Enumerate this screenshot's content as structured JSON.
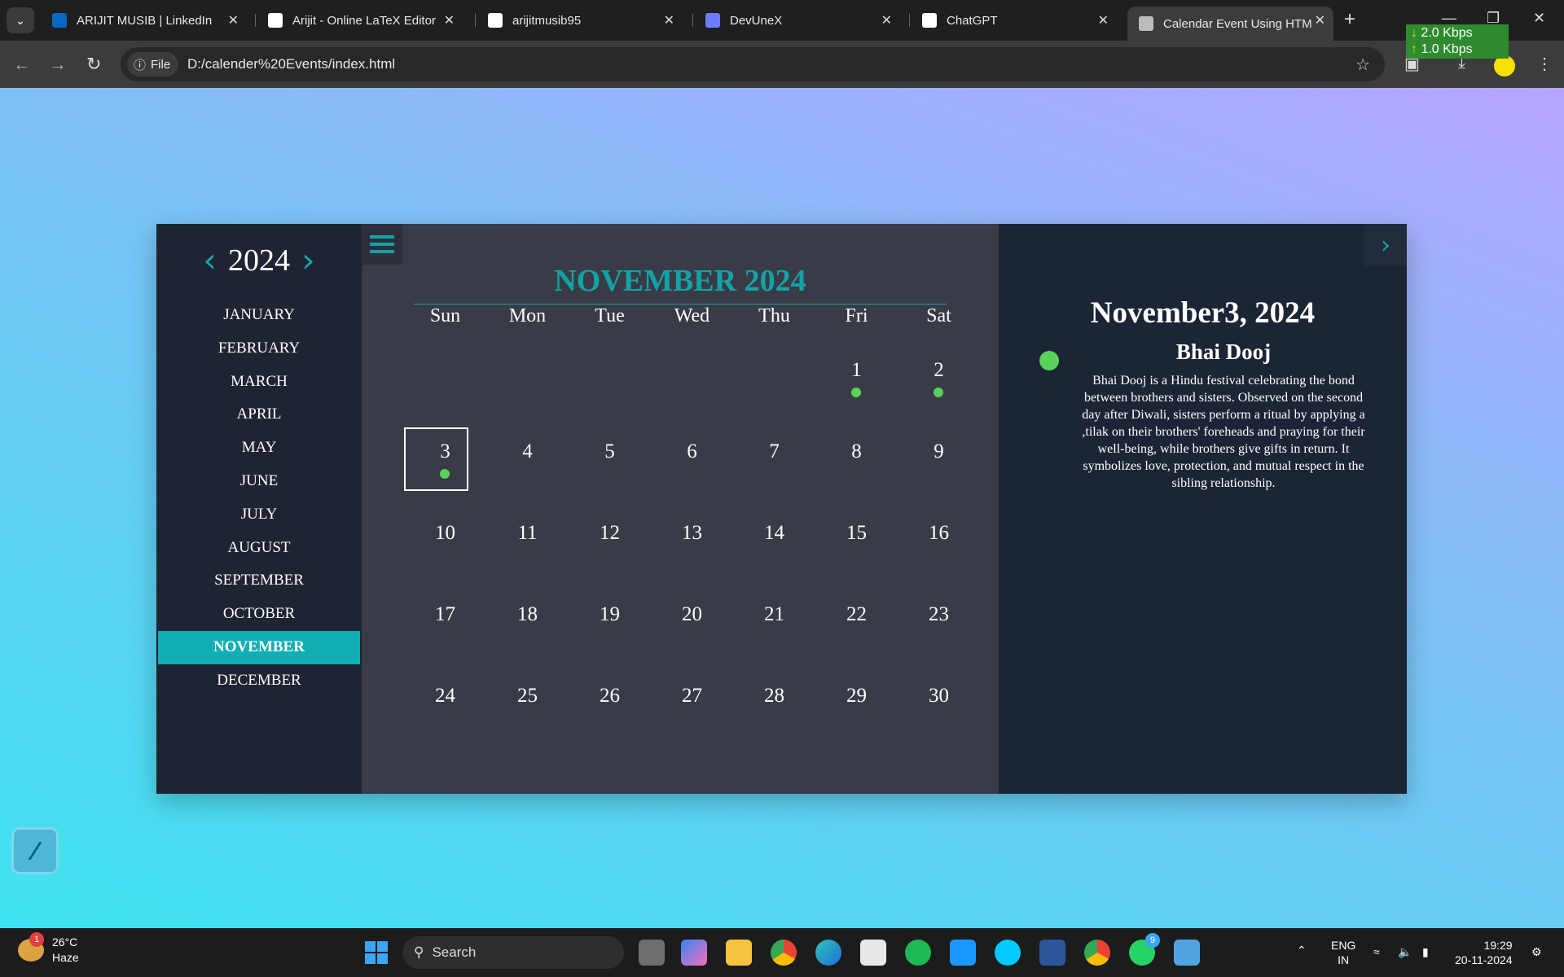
{
  "browser": {
    "tabs": [
      {
        "title": "ARIJIT MUSIB | LinkedIn",
        "favicon": "linkedin-icon",
        "color": "#0a66c2"
      },
      {
        "title": "Arijit - Online LaTeX Editor",
        "favicon": "overleaf-icon",
        "color": "#ffffff"
      },
      {
        "title": "arijitmusib95",
        "favicon": "github-icon",
        "color": "#ffffff"
      },
      {
        "title": "DevUneX",
        "favicon": "devunex-icon",
        "color": "#6b7cff"
      },
      {
        "title": "ChatGPT",
        "favicon": "chatgpt-icon",
        "color": "#ffffff"
      },
      {
        "title": "Calendar Event Using HTM",
        "favicon": "globe-icon",
        "color": "#bbbbbb"
      }
    ],
    "file_chip": "File",
    "url": "D:/calender%20Events/index.html",
    "net_down": "2.0 Kbps",
    "net_up": "1.0 Kbps"
  },
  "calendar": {
    "year": "2024",
    "months": [
      "JANUARY",
      "FEBRUARY",
      "MARCH",
      "APRIL",
      "MAY",
      "JUNE",
      "JULY",
      "AUGUST",
      "SEPTEMBER",
      "OCTOBER",
      "NOVEMBER",
      "DECEMBER"
    ],
    "active_month": "NOVEMBER",
    "title": "NOVEMBER 2024",
    "weekdays": [
      "Sun",
      "Mon",
      "Tue",
      "Wed",
      "Thu",
      "Fri",
      "Sat"
    ],
    "leading_blanks": 5,
    "days_in_month": 30,
    "event_days": [
      1,
      2,
      3
    ],
    "selected_day": 3
  },
  "event_panel": {
    "date": "November3, 2024",
    "title": "Bhai Dooj",
    "description": "Bhai Dooj is a Hindu festival celebrating the bond between brothers and sisters. Observed on the second day after Diwali, sisters perform a ritual by applying a ,tilak on their brothers' foreheads and praying for their well-being, while brothers give gifts in return. It symbolizes love, protection, and mutual respect in the sibling relationship.",
    "dot_color": "#5ad15a"
  },
  "taskbar": {
    "weather_temp": "26°C",
    "weather_desc": "Haze",
    "weather_badge": "1",
    "search_placeholder": "Search",
    "lang_top": "ENG",
    "lang_bottom": "IN",
    "time": "19:29",
    "date": "20-11-2024",
    "whatsapp_badge": "9"
  }
}
